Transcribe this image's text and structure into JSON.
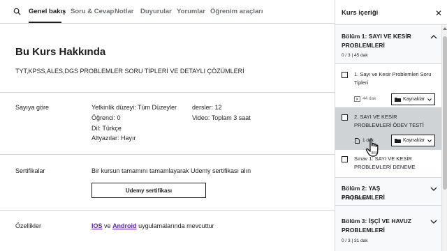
{
  "tabs": {
    "search_icon": "search-icon",
    "items": [
      {
        "label": "Genel bakış",
        "active": true
      },
      {
        "label": "Soru & Cevap"
      },
      {
        "label": "Notlar"
      },
      {
        "label": "Duyurular"
      },
      {
        "label": "Yorumlar"
      },
      {
        "label": "Öğrenim araçları"
      }
    ]
  },
  "about": {
    "title": "Bu Kurs Hakkında",
    "subtitle": "TYT,KPSS,ALES,DGS PROBLEMLER SORU TİPLERİ VE DETAYLI ÇÖZÜMLERİ"
  },
  "numbers": {
    "label": "Sayıya göre",
    "skill_level": "Yetkinlik düzeyi: Tüm Düzeyler",
    "students": "Öğrenci: 0",
    "language": "Dil: Türkçe",
    "captions": "Altyazılar: Hayır",
    "lectures": "dersler: 12",
    "video": "Video: Toplam 3 saat"
  },
  "certificates": {
    "label": "Sertifikalar",
    "description": "Bir kursun tamamını tamamlayarak Udemy sertifikası alın",
    "button": "Udemy sertifikası"
  },
  "features": {
    "label": "Özellikler",
    "ios": "IOS",
    "and": "ve",
    "android": "Android",
    "rest": "uygulamalarında mevcuttur"
  },
  "sidebar": {
    "title": "Kurs içeriği",
    "close_icon": "close-icon",
    "sections": [
      {
        "name": "Bölüm 1: SAYI VE KESİR PROBLEMLERİ",
        "meta": "0 / 3 | 45 dak",
        "expanded": true,
        "lectures": [
          {
            "title": "1. Sayı ve Kesir Problemleri Soru Tipleri",
            "duration": "44 dak",
            "icon": "video-icon",
            "resources": "Kaynaklar"
          },
          {
            "title": "2. SAYI VE KESİR PROBLEMLERİ ÖDEV TESTİ",
            "duration": "1 dak",
            "icon": "document-icon",
            "resources": "Kaynaklar",
            "current": true
          },
          {
            "title": "Sınav 1: SAYI VE KESİR PROBLEMLERİ DENEME"
          }
        ]
      },
      {
        "name": "Bölüm 2: YAŞ PROBLEMLERİ",
        "meta": "0 / 3 | 24 dak"
      },
      {
        "name": "Bölüm 3: İŞÇİ VE HAVUZ PROBLEMLERİ",
        "meta": "0 / 3 | 31 dak"
      }
    ]
  },
  "colors": {
    "text": "#1c1d1f",
    "muted": "#6a6f73",
    "link": "#5624d0",
    "border": "#d1d7dc",
    "section_bg": "#f7f9fa",
    "current_lecture_bg": "#cfd3d6"
  }
}
